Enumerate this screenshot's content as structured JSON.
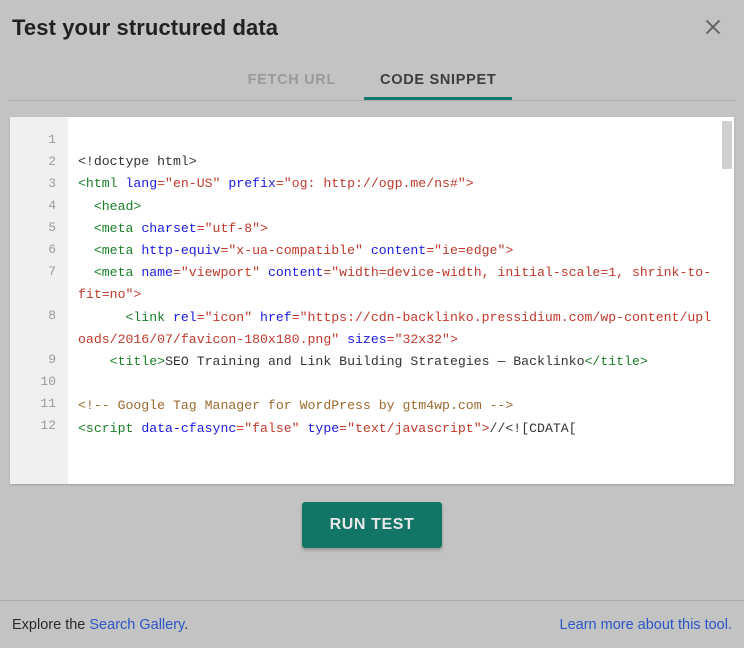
{
  "dialog": {
    "title": "Test your structured data",
    "close_icon": "close-icon"
  },
  "tabs": [
    {
      "label": "FETCH URL",
      "active": false
    },
    {
      "label": "CODE SNIPPET",
      "active": true
    }
  ],
  "editor": {
    "line_numbers": [
      "1",
      "2",
      "3",
      "4",
      "5",
      "6",
      "7",
      "8",
      "9",
      "10",
      "11",
      "12"
    ],
    "lines": [
      {
        "number": "1",
        "tokens": []
      },
      {
        "number": "2",
        "tokens": [
          {
            "t": "plain",
            "s": "<!doctype html>"
          }
        ]
      },
      {
        "number": "3",
        "tokens": [
          {
            "t": "tag",
            "s": "<html "
          },
          {
            "t": "attr",
            "s": "lang"
          },
          {
            "t": "val",
            "s": "=\"en-US\" "
          },
          {
            "t": "attr",
            "s": "prefix"
          },
          {
            "t": "val",
            "s": "=\"og: http://ogp.me/ns#\">"
          }
        ]
      },
      {
        "number": "4",
        "tokens": [
          {
            "t": "tag",
            "s": "  <head>"
          }
        ]
      },
      {
        "number": "5",
        "tokens": [
          {
            "t": "tag",
            "s": "  <meta "
          },
          {
            "t": "attr",
            "s": "charset"
          },
          {
            "t": "val",
            "s": "=\"utf-8\">"
          }
        ]
      },
      {
        "number": "6",
        "tokens": [
          {
            "t": "tag",
            "s": "  <meta "
          },
          {
            "t": "attr",
            "s": "http-equiv"
          },
          {
            "t": "val",
            "s": "=\"x-ua-compatible\" "
          },
          {
            "t": "attr",
            "s": "content"
          },
          {
            "t": "val",
            "s": "=\"ie=edge\">"
          }
        ]
      },
      {
        "number": "7",
        "tokens": [
          {
            "t": "tag",
            "s": "  <meta "
          },
          {
            "t": "attr",
            "s": "name"
          },
          {
            "t": "val",
            "s": "=\"viewport\" "
          },
          {
            "t": "attr",
            "s": "content"
          },
          {
            "t": "val",
            "s": "=\"width=device-width, initial-scale=1, shrink-to-fit=no\">"
          }
        ]
      },
      {
        "number": "8",
        "tokens": [
          {
            "t": "tag",
            "s": "      <link "
          },
          {
            "t": "attr",
            "s": "rel"
          },
          {
            "t": "val",
            "s": "=\"icon\" "
          },
          {
            "t": "attr",
            "s": "href"
          },
          {
            "t": "val",
            "s": "=\"https://cdn-backlinko.pressidium.com/wp-content/uploads/2016/07/favicon-180x180.png\" "
          },
          {
            "t": "attr",
            "s": "sizes"
          },
          {
            "t": "val",
            "s": "=\"32x32\">"
          }
        ]
      },
      {
        "number": "9",
        "tokens": [
          {
            "t": "tag",
            "s": "    <title>"
          },
          {
            "t": "plain",
            "s": "SEO Training and Link Building Strategies — Backlinko"
          },
          {
            "t": "tag",
            "s": "</title>"
          }
        ]
      },
      {
        "number": "10",
        "tokens": []
      },
      {
        "number": "11",
        "tokens": [
          {
            "t": "comment",
            "s": "<!-- Google Tag Manager for WordPress by gtm4wp.com -->"
          }
        ]
      },
      {
        "number": "12",
        "tokens": [
          {
            "t": "tag",
            "s": "<script "
          },
          {
            "t": "attr",
            "s": "data-cfasync"
          },
          {
            "t": "val",
            "s": "=\"false\" "
          },
          {
            "t": "attr",
            "s": "type"
          },
          {
            "t": "val",
            "s": "=\"text/javascript\">"
          },
          {
            "t": "plain",
            "s": "//<![CDATA["
          }
        ]
      }
    ]
  },
  "actions": {
    "run_test_label": "RUN TEST"
  },
  "footer": {
    "explore_prefix": "Explore the ",
    "gallery_link": "Search Gallery",
    "explore_suffix": ".",
    "learn_more_link": "Learn more about this tool."
  },
  "colors": {
    "accent_teal": "#137566",
    "link_blue": "#2a56c6",
    "tag_green": "#1a7f28",
    "attr_blue": "#1a1ae6",
    "value_red": "#c0392b",
    "comment_brown": "#9b6a2f",
    "background_gray": "#c3c3c3"
  }
}
